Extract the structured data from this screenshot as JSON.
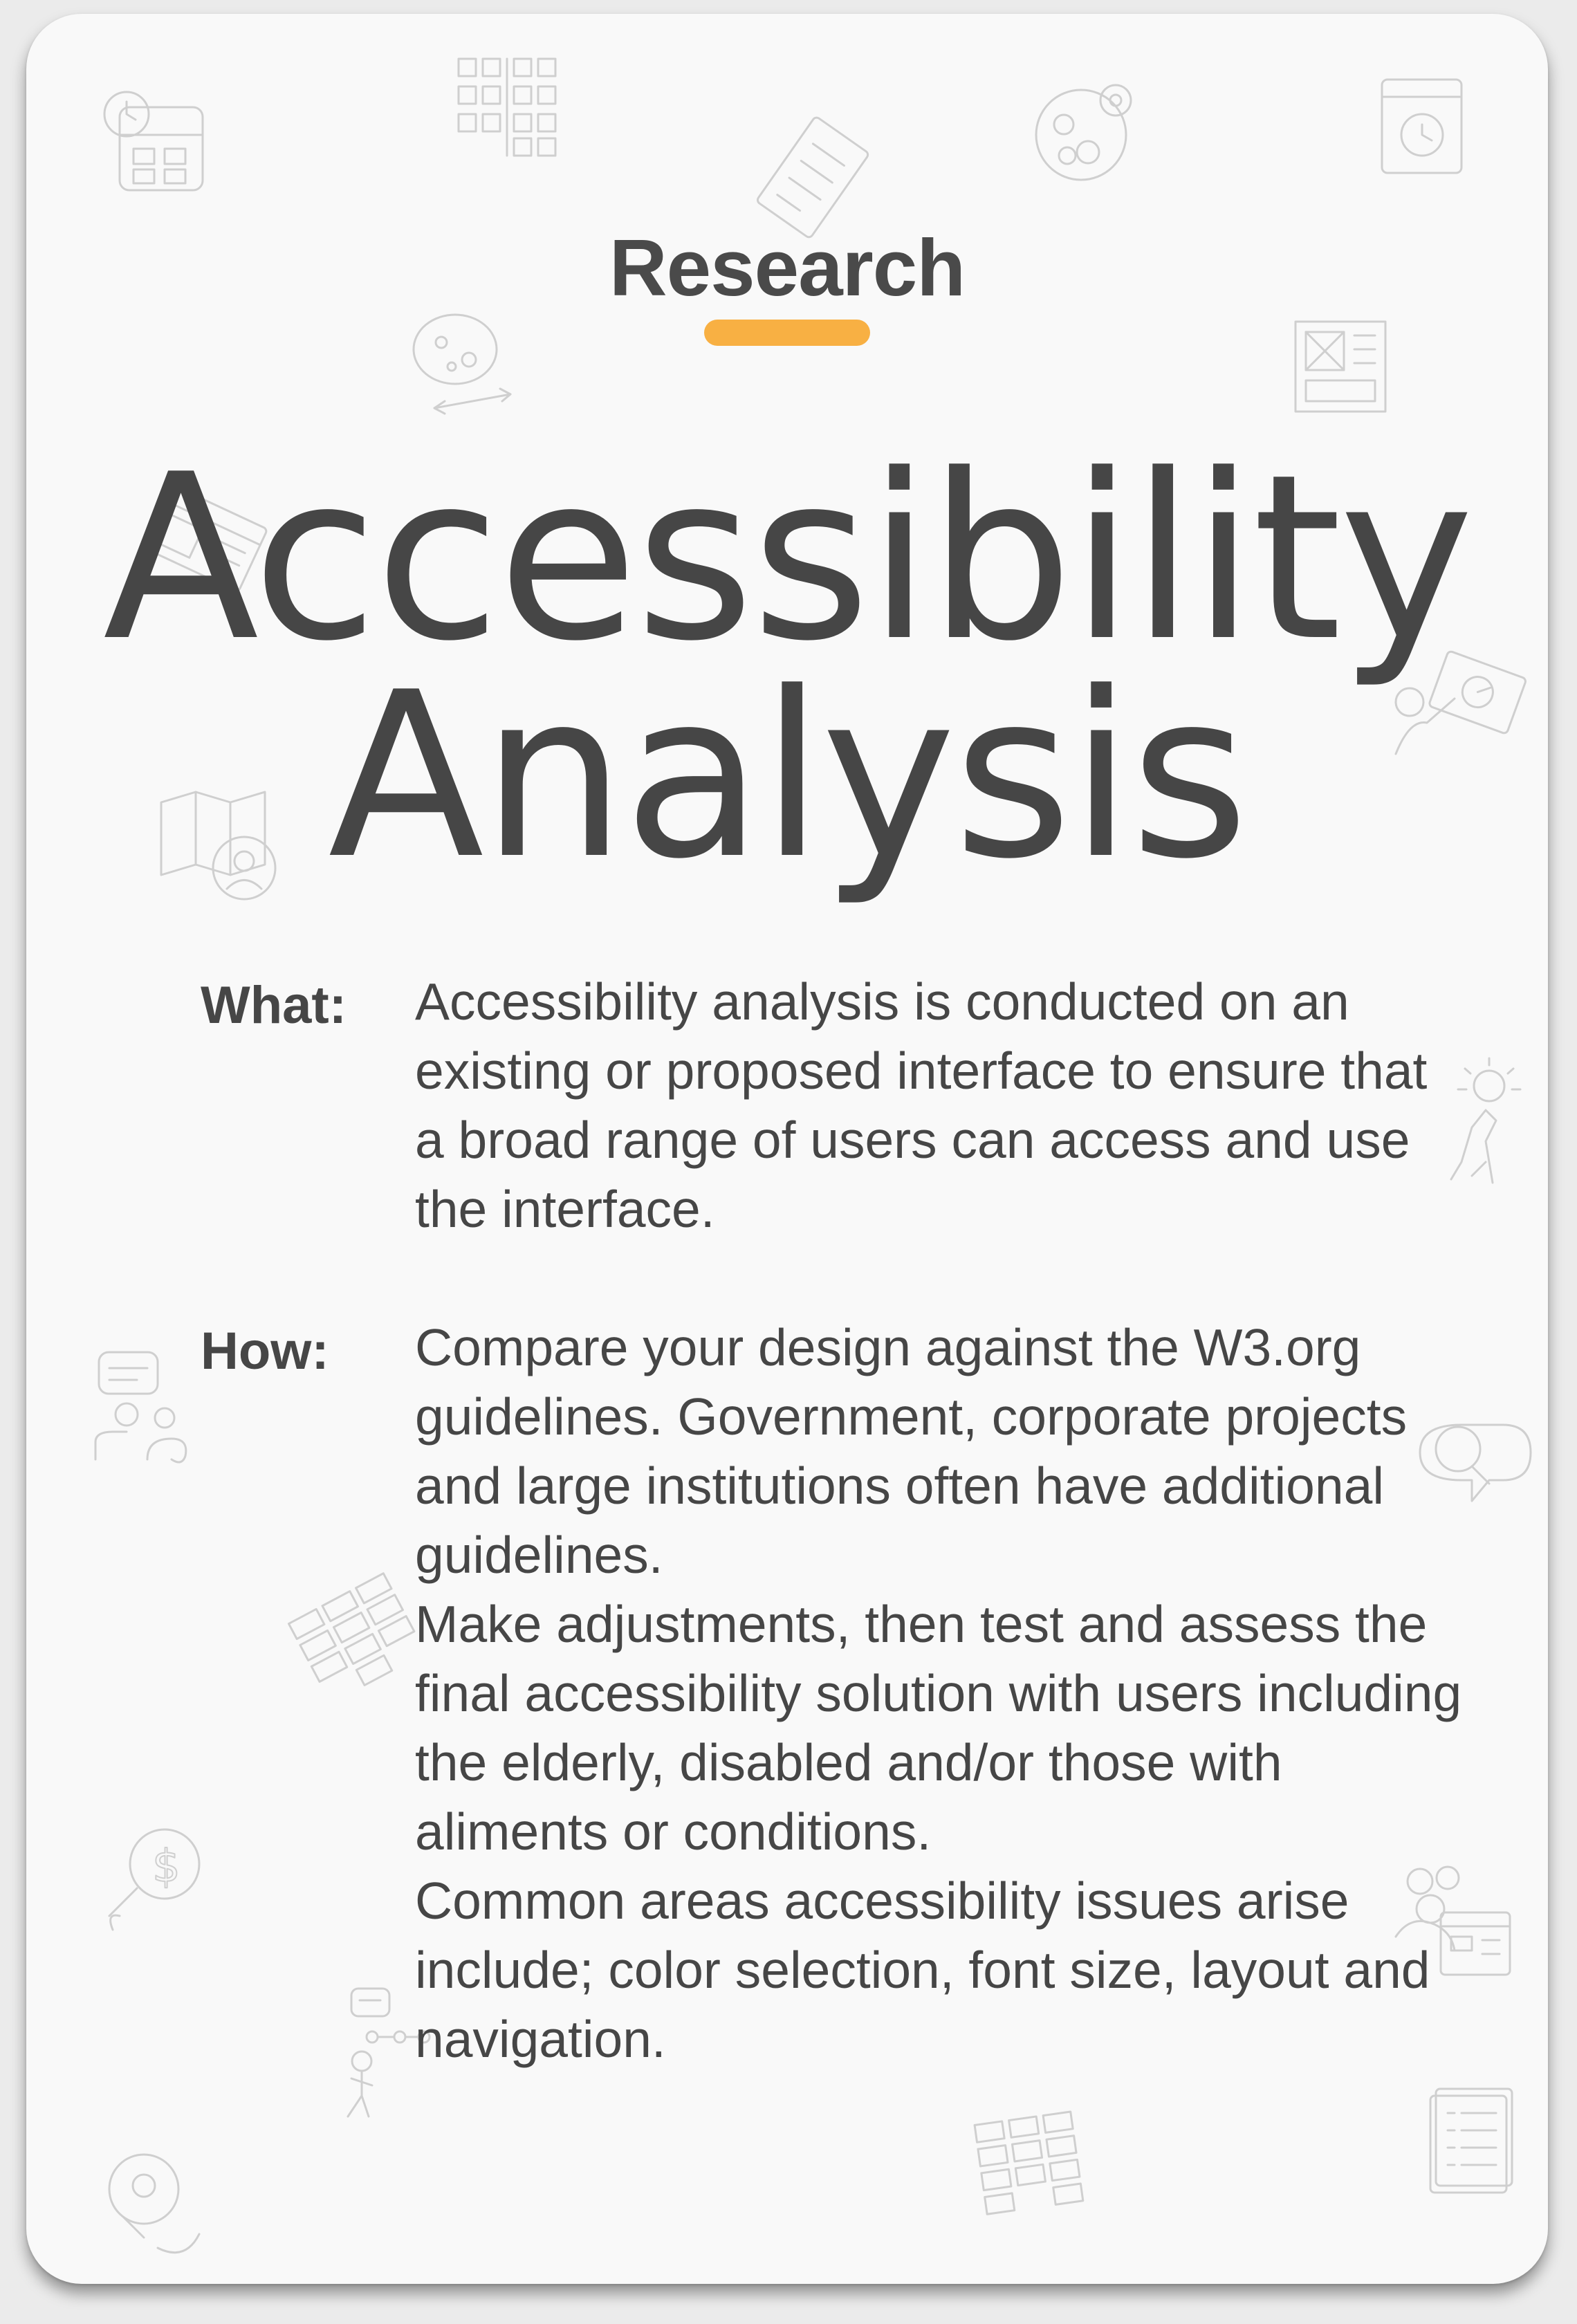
{
  "card": {
    "category": "Research",
    "title_line1": "Accessibility",
    "title_line2": "Analysis",
    "what_label": "What:",
    "what_text": "Accessibility analysis is conducted on an existing or proposed interface to ensure that a broad range of users can access and use the interface.",
    "how_label": "How:",
    "how_paragraphs": [
      "Compare your design against the W3.org guidelines. Government, corporate projects and large institutions often have additional guidelines.",
      "Make adjustments, then test and assess the final accessibility solution with users including the elderly, disabled and/or those with aliments or conditions.",
      "Common areas accessibility issues arise include; color selection, font size, layout and navigation."
    ]
  },
  "colors": {
    "accent": "#f8b043",
    "text": "#464646",
    "card_background": "#f9f9f9",
    "decoration": "#cfcfcf"
  },
  "decorative_icons": [
    "calendar-clock-icon",
    "grid-icon",
    "checklist-icon",
    "map-pins-icon",
    "history-document-icon",
    "map-route-icon",
    "wireframe-icon",
    "wireframe-pointer-icon",
    "presentation-icon",
    "map-search-icon",
    "idea-person-icon",
    "user-chat-icon",
    "search-chat-icon",
    "card-sort-icon",
    "dollar-pin-icon",
    "people-dashboard-icon",
    "flow-person-icon",
    "grid-cards-icon",
    "document-list-icon",
    "location-path-icon"
  ]
}
